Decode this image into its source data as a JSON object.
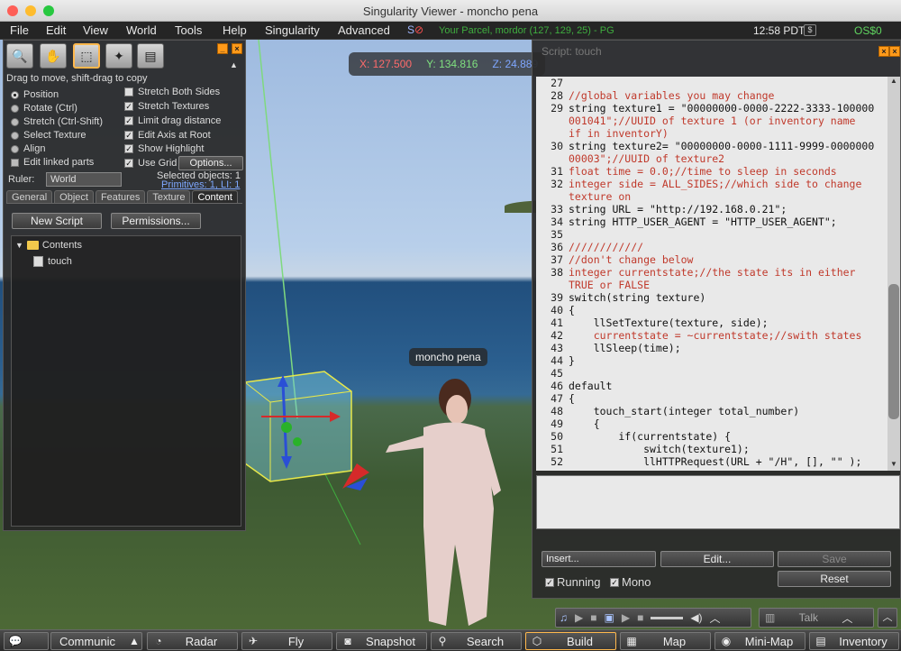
{
  "window": {
    "title": "Singularity Viewer - moncho pena"
  },
  "menu": {
    "items": [
      "File",
      "Edit",
      "View",
      "World",
      "Tools",
      "Help",
      "Singularity",
      "Advanced"
    ],
    "parcel": "Your Parcel, mordor (127, 129, 25) - PG",
    "clock": "12:58 PDT",
    "balance": "OS$0"
  },
  "hud": {
    "x": "X: 127.500",
    "y": "Y: 134.816",
    "z": "Z: 24.889"
  },
  "avatar": {
    "name": "moncho pena"
  },
  "build": {
    "hint": "Drag to move, shift-drag to copy",
    "modes": [
      {
        "label": "Position",
        "selected": true
      },
      {
        "label": "Rotate (Ctrl)",
        "selected": false
      },
      {
        "label": "Stretch (Ctrl-Shift)",
        "selected": false
      },
      {
        "label": "Select Texture",
        "selected": false
      },
      {
        "label": "Align",
        "selected": false
      }
    ],
    "edit_linked": "Edit linked parts",
    "options": [
      {
        "label": "Stretch Both Sides",
        "checked": false
      },
      {
        "label": "Stretch Textures",
        "checked": true
      },
      {
        "label": "Limit drag distance",
        "checked": true
      },
      {
        "label": "Edit Axis at Root",
        "checked": true
      },
      {
        "label": "Show Highlight",
        "checked": true
      },
      {
        "label": "Use Grid",
        "checked": true
      }
    ],
    "options_button": "Options...",
    "ruler_label": "Ruler:",
    "ruler_value": "World",
    "selected_objects": "Selected objects: 1",
    "primitives": "Primitives: 1, LI: 1",
    "tabs": [
      "General",
      "Object",
      "Features",
      "Texture",
      "Content"
    ],
    "active_tab": "Content",
    "new_script": "New Script",
    "permissions": "Permissions...",
    "tree_root": "Contents",
    "tree_item": "touch"
  },
  "script": {
    "title": "Script: touch",
    "lines": [
      {
        "n": "27",
        "t": ""
      },
      {
        "n": "28",
        "t": "//global variables you may change"
      },
      {
        "n": "29",
        "t": "string texture1 = \"00000000-0000-2222-3333-100000"
      },
      {
        "n": "",
        "t": "001041\";//UUID of texture 1 (or inventory name"
      },
      {
        "n": "",
        "t": "if in inventorY)"
      },
      {
        "n": "30",
        "t": "string texture2= \"00000000-0000-1111-9999-0000000"
      },
      {
        "n": "",
        "t": "00003\";//UUID of texture2"
      },
      {
        "n": "31",
        "t": "float time = 0.0;//time to sleep in seconds"
      },
      {
        "n": "32",
        "t": "integer side = ALL_SIDES;//which side to change"
      },
      {
        "n": "",
        "t": "texture on"
      },
      {
        "n": "33",
        "t": "string URL = \"http://192.168.0.21\";"
      },
      {
        "n": "34",
        "t": "string HTTP_USER_AGENT = \"HTTP_USER_AGENT\";"
      },
      {
        "n": "35",
        "t": ""
      },
      {
        "n": "36",
        "t": "////////////"
      },
      {
        "n": "37",
        "t": "//don't change below"
      },
      {
        "n": "38",
        "t": "integer currentstate;//the state its in either"
      },
      {
        "n": "",
        "t": "TRUE or FALSE"
      },
      {
        "n": "39",
        "t": "switch(string texture)"
      },
      {
        "n": "40",
        "t": "{"
      },
      {
        "n": "41",
        "t": "    llSetTexture(texture, side);"
      },
      {
        "n": "42",
        "t": "    currentstate = ~currentstate;//swith states"
      },
      {
        "n": "43",
        "t": "    llSleep(time);"
      },
      {
        "n": "44",
        "t": "}"
      },
      {
        "n": "45",
        "t": ""
      },
      {
        "n": "46",
        "t": "default"
      },
      {
        "n": "47",
        "t": "{"
      },
      {
        "n": "48",
        "t": "    touch_start(integer total_number)"
      },
      {
        "n": "49",
        "t": "    {"
      },
      {
        "n": "50",
        "t": "        if(currentstate) {"
      },
      {
        "n": "51",
        "t": "            switch(texture1);"
      },
      {
        "n": "52",
        "t": "            llHTTPRequest(URL + \"/H\", [], \"\" );"
      }
    ],
    "insert": "Insert...",
    "edit": "Edit...",
    "save": "Save",
    "reset": "Reset",
    "running": "Running",
    "mono": "Mono"
  },
  "bottombar": {
    "items": [
      {
        "label": "Communic",
        "icon": "chat-icon"
      },
      {
        "label": "Radar",
        "icon": "radar-icon"
      },
      {
        "label": "Fly",
        "icon": "fly-icon"
      },
      {
        "label": "Snapshot",
        "icon": "camera-icon"
      },
      {
        "label": "Search",
        "icon": "search-icon"
      },
      {
        "label": "Build",
        "icon": "build-icon"
      },
      {
        "label": "Map",
        "icon": "map-icon"
      },
      {
        "label": "Mini-Map",
        "icon": "minimap-icon"
      },
      {
        "label": "Inventory",
        "icon": "inventory-icon"
      }
    ],
    "talk": "Talk"
  },
  "colors": {
    "accent": "#ffb84d",
    "positive": "#3fae3f",
    "selection_box": "#e8e84a"
  }
}
